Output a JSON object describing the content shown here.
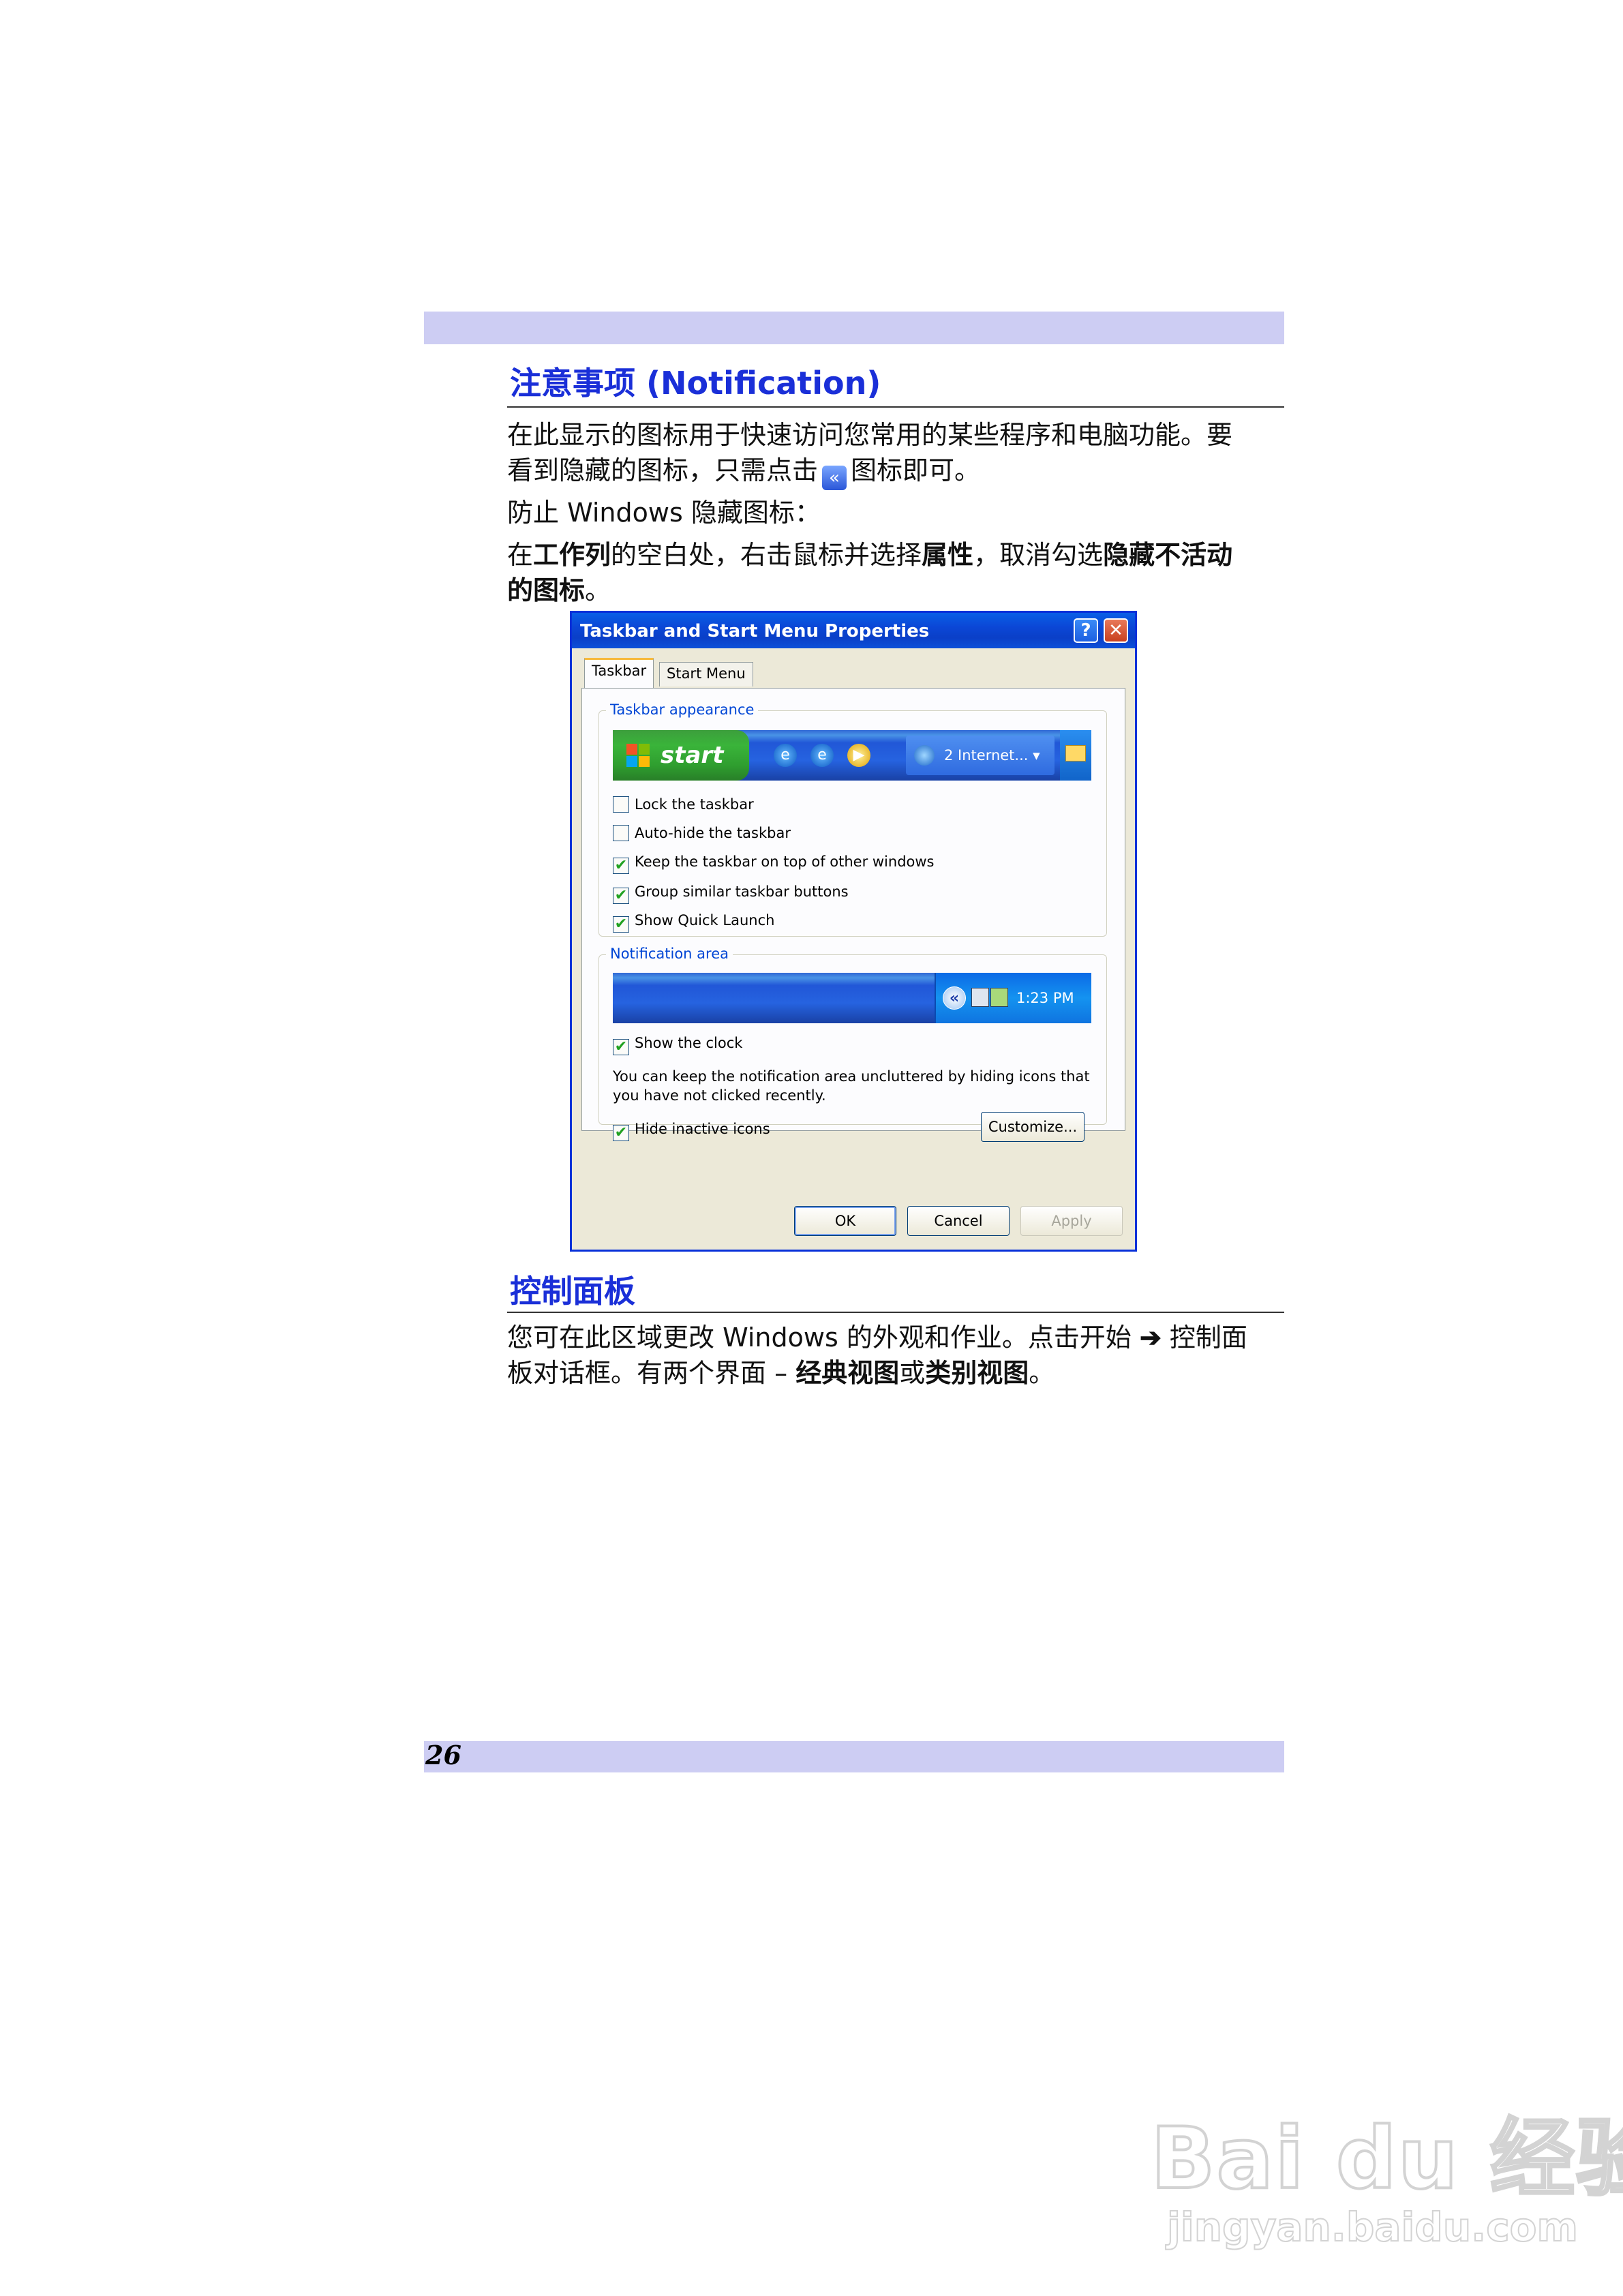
{
  "section1": {
    "heading": "注意事项 (Notification)",
    "para1_line1": "在此显示的图标用于快速访问您常用的某些程序和电脑功能。要",
    "para1_line2a": "看到隐藏的图标，只需点击",
    "para1_line2b": "图标即可。",
    "para1_icon": "«",
    "para2_a": "防止",
    "para2_windows": "Windows",
    "para2_b": "隐藏图标：",
    "para3_a": "在",
    "para3_b1": "工作列",
    "para3_c": "的空白处，右击鼠标并选择",
    "para3_b2": "属性",
    "para3_d": "，取消勾选",
    "para3_b3": "隐藏不活动",
    "para3_b4": "的图标",
    "para3_e": "。"
  },
  "dialog": {
    "title": "Taskbar and Start Menu Properties",
    "help_glyph": "?",
    "close_glyph": "✕",
    "tabs": [
      "Taskbar",
      "Start Menu"
    ],
    "taskbar_appearance": {
      "legend": "Taskbar appearance",
      "start_label": "start",
      "task_item_label": "2 Internet...",
      "task_item_arrow": "▾",
      "quick_launch_glyphs": [
        "e",
        "e",
        "▶"
      ],
      "options": [
        {
          "label": "Lock the taskbar",
          "checked": false
        },
        {
          "label": "Auto-hide the taskbar",
          "checked": false
        },
        {
          "label": "Keep the taskbar on top of other windows",
          "checked": true
        },
        {
          "label": "Group similar taskbar buttons",
          "checked": true
        },
        {
          "label": "Show Quick Launch",
          "checked": true
        }
      ]
    },
    "notification_area": {
      "legend": "Notification area",
      "chevron_glyph": "«",
      "clock_text": "1:23 PM",
      "show_clock_label": "Show the clock",
      "show_clock_checked": true,
      "description": "You can keep the notification area uncluttered by hiding icons that you have not clicked recently.",
      "hide_inactive_label": "Hide inactive icons",
      "hide_inactive_checked": true,
      "customize_label": "Customize..."
    },
    "buttons": {
      "ok": "OK",
      "cancel": "Cancel",
      "apply": "Apply"
    },
    "check_glyph": "✔"
  },
  "section2": {
    "heading": "控制面板",
    "line1_a": "您可在此区域更改",
    "line1_windows": "Windows",
    "line1_b": "的外观和作业。点击开始",
    "arrow": "➔",
    "line1_c": "控制面",
    "line2_a": "板对话框。有两个界面",
    "dash": "–",
    "line2_b1": "经典视图",
    "line2_c": "或",
    "line2_b2": "类别视图",
    "line2_d": "。"
  },
  "footer": {
    "page_number": "26"
  },
  "watermark": {
    "brand": "Bai du 经验",
    "url": "jingyan.baidu.com"
  }
}
